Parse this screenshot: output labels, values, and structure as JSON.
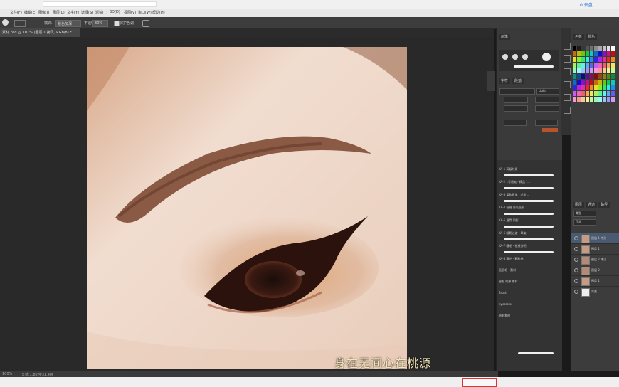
{
  "browser": {
    "right_label": "0 云盘"
  },
  "menu": {
    "items": [
      "文件(F)",
      "编辑(E)",
      "图像(I)",
      "图层(L)",
      "文字(Y)",
      "选择(S)",
      "滤镜(T)",
      "3D(D)",
      "视图(V)",
      "窗口(W)",
      "帮助(H)"
    ]
  },
  "options": {
    "mode_label": "模式:",
    "mode_value": "颜色加深",
    "opacity_label": "不透明度:",
    "opacity_value": "30%",
    "protect_label": "保护色调"
  },
  "document": {
    "tab_label": "素材.psd @ 101% (图层 1 拷贝, RGB/8) *",
    "zoom": "100%",
    "doc_info": "文档:1.82M/31.4M"
  },
  "brush_panel": {
    "tab1": "画笔",
    "tab2": "字符",
    "tab3": "段落",
    "font_style": "Light",
    "folder_items": [
      "KA-1 高级线条",
      "KA-2 1号眉笔 - 精品 1...",
      "KA-3 柔和眉笔 - 毛发...",
      "KA-4 画眉 眉毛绘制",
      "KA-5 眉骨 阴影",
      "KA-6 眼影过渡 - 晕染",
      "KA-7 睫毛 - 根根分明",
      "KA-8 高光 - 颗粒感",
      "画眉毛 - 素材",
      "眉毛 效果 素材",
      "Brush",
      "eyebrows",
      "眉毛素材"
    ]
  },
  "layers": {
    "tabs": [
      "图层",
      "通道",
      "路径"
    ],
    "kind_label": "类型",
    "mode_label": "正常",
    "items": [
      {
        "name": "图层 1 拷贝"
      },
      {
        "name": "图层 1"
      },
      {
        "name": "图层 2 拷贝"
      },
      {
        "name": "图层 2"
      },
      {
        "name": "图层 1"
      },
      {
        "name": "背景"
      }
    ]
  },
  "swatches": {
    "tab1": "色板",
    "tab2": "颜色"
  },
  "subtitle": "身在无间心在桃源"
}
